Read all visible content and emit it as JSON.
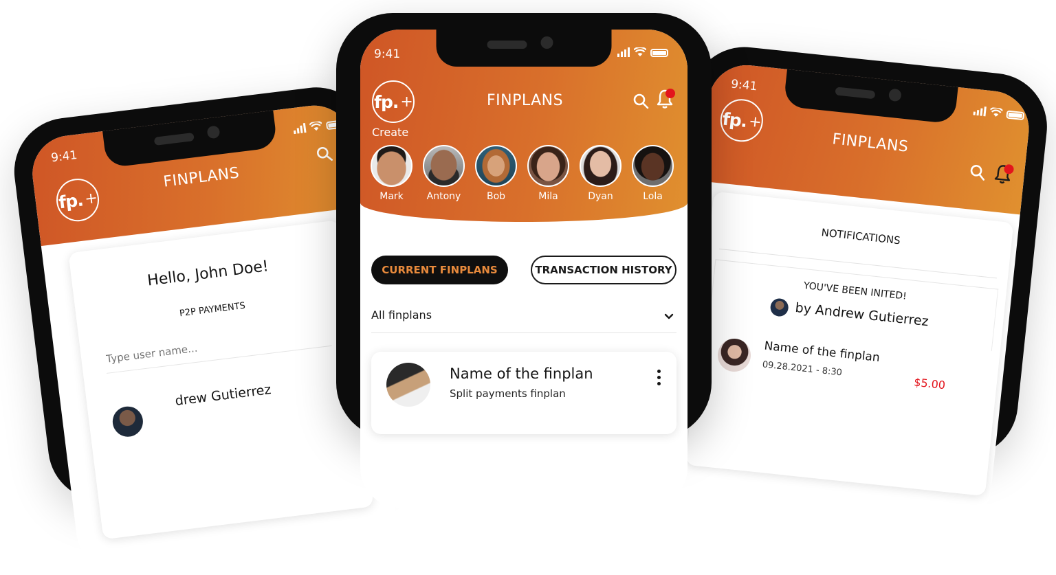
{
  "left_phone": {
    "status_time": "9:41",
    "logo_text": "fp.",
    "logo_plus": "+",
    "title": "FINPLANS",
    "greeting": "Hello, John Doe!",
    "section_label": "P2P PAYMENTS",
    "search_placeholder": "Type user name...",
    "partial_name": "drew Gutierrez"
  },
  "center_phone": {
    "status_time": "9:41",
    "logo_text": "fp.",
    "logo_plus": "+",
    "create_label": "Create",
    "title": "FINPLANS",
    "contacts": [
      {
        "name": "Mark"
      },
      {
        "name": "Antony"
      },
      {
        "name": "Bob"
      },
      {
        "name": "Mila"
      },
      {
        "name": "Dyan"
      },
      {
        "name": "Lola"
      }
    ],
    "tabs": [
      {
        "label": "CURRENT FINPLANS",
        "active": true
      },
      {
        "label": "TRANSACTION HISTORY",
        "active": false
      }
    ],
    "filter": {
      "selected": "All finplans"
    },
    "finplan_card": {
      "name": "Name of the finplan",
      "subtitle": "Split payments finplan"
    }
  },
  "right_phone": {
    "status_time": "9:41",
    "logo_text": "fp.",
    "logo_plus": "+",
    "title": "FINPLANS",
    "notifications_title": "NOTIFICATIONS",
    "invite_title": "YOU'VE BEEN INITED!",
    "invite_by": "by Andrew Gutierrez",
    "item_name": "Name of the finplan",
    "item_date": "09.28.2021 - 8:30",
    "item_amount": "$5.00"
  },
  "colors": {
    "accent_start": "#cf5626",
    "accent_end": "#e0902f",
    "active_tab_text": "#e88a3c",
    "notification_dot": "#e3141c",
    "amount_red": "#e3141c"
  },
  "icons": [
    "search-icon",
    "bell-icon",
    "chevron-down-icon",
    "more-vertical-icon",
    "signal-icon",
    "wifi-icon",
    "battery-icon"
  ]
}
